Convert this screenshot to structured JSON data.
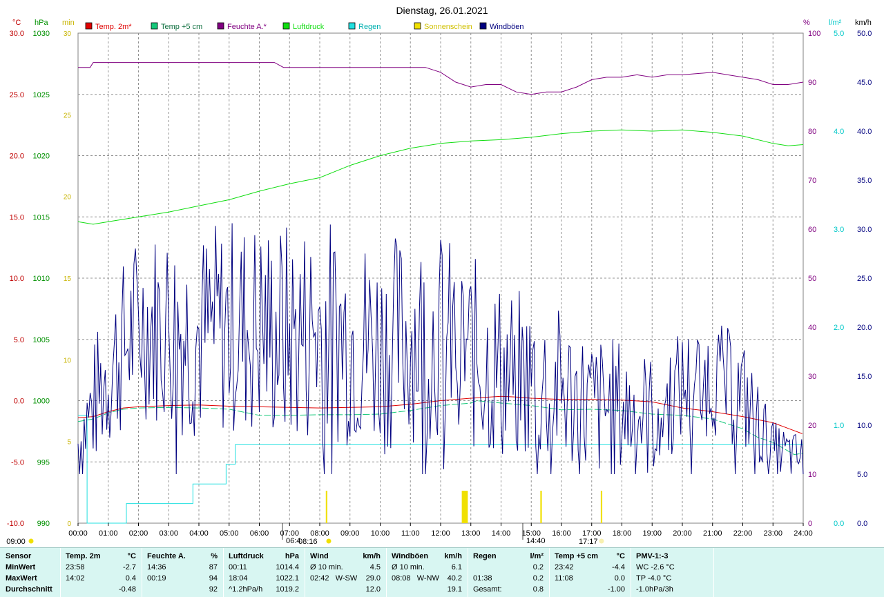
{
  "title": "Dienstag, 26.01.2021",
  "colors": {
    "temp2m": "#e00000",
    "temp5cm": "#14c87a",
    "feuchte": "#800080",
    "luftdruck": "#10dd10",
    "regen": "#22e0e0",
    "sonne": "#f0e000",
    "wind": "#00007f",
    "grid": "#909090",
    "stats_bg": "#d8f6f2"
  },
  "legend": [
    {
      "key": "temp2m",
      "label": "Temp. 2m*"
    },
    {
      "key": "temp5cm",
      "label": "Temp +5 cm"
    },
    {
      "key": "feuchte",
      "label": "Feuchte A.*"
    },
    {
      "key": "luftdruck",
      "label": "Luftdruck"
    },
    {
      "key": "regen",
      "label": "Regen"
    },
    {
      "key": "sonne",
      "label": "Sonnenschein"
    },
    {
      "key": "wind",
      "label": "Windböen"
    }
  ],
  "axis_units": {
    "temp": "°C",
    "press": "hPa",
    "sun": "min",
    "hum": "%",
    "rain": "l/m²",
    "wind": "km/h"
  },
  "axes": {
    "temp": {
      "ticks": [
        "30.0",
        "25.0",
        "20.0",
        "15.0",
        "10.0",
        "5.0",
        "0.0",
        "-5.0",
        "-10.0"
      ]
    },
    "press": {
      "ticks": [
        "1030",
        "1025",
        "1020",
        "1015",
        "1010",
        "1005",
        "1000",
        "995",
        "990"
      ]
    },
    "sun": {
      "ticks": [
        "30",
        "25",
        "20",
        "15",
        "10",
        "5",
        "0"
      ]
    },
    "hum": {
      "ticks": [
        "100",
        "90",
        "80",
        "70",
        "60",
        "50",
        "40",
        "30",
        "20",
        "10",
        "0"
      ]
    },
    "rain": {
      "ticks": [
        "5.0",
        "4.0",
        "3.0",
        "2.0",
        "1.0",
        "0.0"
      ]
    },
    "wind": {
      "ticks": [
        "50.0",
        "45.0",
        "40.0",
        "35.0",
        "30.0",
        "25.0",
        "20.0",
        "15.0",
        "10.0",
        "5.0",
        "0.0"
      ]
    },
    "time": {
      "ticks": [
        "00:00",
        "01:00",
        "02:00",
        "03:00",
        "04:00",
        "05:00",
        "06:00",
        "07:00",
        "08:00",
        "09:00",
        "10:00",
        "11:00",
        "12:00",
        "13:00",
        "14:00",
        "15:00",
        "16:00",
        "17:00",
        "18:00",
        "19:00",
        "20:00",
        "21:00",
        "22:00",
        "23:00",
        "24:00"
      ]
    }
  },
  "markers": {
    "sunrise": "08:16",
    "sunset": "17:17",
    "min_marker": "06:4",
    "max_marker": "14:40",
    "sun_duration": "09:00"
  },
  "chart_data": {
    "type": "line",
    "title": "Dienstag, 26.01.2021",
    "x_range": [
      "00:00",
      "24:00"
    ],
    "series": [
      {
        "name": "Temp. 2m*",
        "axis": "temp",
        "ylim": [
          -10,
          30
        ],
        "points": [
          [
            0,
            -1.4
          ],
          [
            0.5,
            -1.3
          ],
          [
            1,
            -0.9
          ],
          [
            1.5,
            -0.6
          ],
          [
            2,
            -0.5
          ],
          [
            3,
            -0.4
          ],
          [
            4,
            -0.35
          ],
          [
            5,
            -0.45
          ],
          [
            6,
            -0.5
          ],
          [
            7,
            -0.55
          ],
          [
            8,
            -0.6
          ],
          [
            9,
            -0.55
          ],
          [
            10,
            -0.5
          ],
          [
            11,
            -0.3
          ],
          [
            12,
            0.0
          ],
          [
            13,
            0.2
          ],
          [
            14,
            0.35
          ],
          [
            14.5,
            0.3
          ],
          [
            15,
            0.2
          ],
          [
            16,
            0.1
          ],
          [
            17,
            0.1
          ],
          [
            18,
            0.05
          ],
          [
            19,
            -0.1
          ],
          [
            20,
            -0.6
          ],
          [
            21,
            -0.9
          ],
          [
            22,
            -1.3
          ],
          [
            23,
            -1.8
          ],
          [
            23.97,
            -2.7
          ]
        ]
      },
      {
        "name": "Temp +5 cm",
        "axis": "temp",
        "ylim": [
          -10,
          30
        ],
        "points": [
          [
            0,
            -1.7
          ],
          [
            0.5,
            -1.5
          ],
          [
            1,
            -1.0
          ],
          [
            1.5,
            -0.7
          ],
          [
            2,
            -0.6
          ],
          [
            3,
            -0.55
          ],
          [
            4,
            -0.6
          ],
          [
            5,
            -0.7
          ],
          [
            6,
            -1.2
          ],
          [
            7,
            -1.2
          ],
          [
            8,
            -1.15
          ],
          [
            9,
            -1.15
          ],
          [
            10,
            -1.1
          ],
          [
            11,
            -0.8
          ],
          [
            12,
            -0.4
          ],
          [
            13,
            -0.2
          ],
          [
            13.2,
            0.0
          ],
          [
            14,
            -0.2
          ],
          [
            15,
            -0.4
          ],
          [
            16,
            -0.75
          ],
          [
            17,
            -0.7
          ],
          [
            18,
            -0.8
          ],
          [
            19,
            -1.1
          ],
          [
            20,
            -1.2
          ],
          [
            21,
            -1.5
          ],
          [
            22,
            -2.3
          ],
          [
            22.5,
            -3.0
          ],
          [
            23,
            -3.4
          ],
          [
            23.7,
            -4.4
          ],
          [
            24,
            -4.3
          ]
        ]
      },
      {
        "name": "Feuchte A.*",
        "axis": "hum",
        "ylim": [
          0,
          100
        ],
        "points": [
          [
            0,
            93
          ],
          [
            0.4,
            93
          ],
          [
            0.5,
            94
          ],
          [
            1,
            94
          ],
          [
            2,
            94
          ],
          [
            3,
            94
          ],
          [
            4,
            94
          ],
          [
            5,
            94
          ],
          [
            6,
            94
          ],
          [
            6.5,
            94
          ],
          [
            6.8,
            93
          ],
          [
            7,
            93
          ],
          [
            8,
            93
          ],
          [
            9,
            93
          ],
          [
            10,
            93
          ],
          [
            11,
            93
          ],
          [
            11.5,
            93
          ],
          [
            12,
            92
          ],
          [
            12.5,
            90
          ],
          [
            13,
            89
          ],
          [
            13.5,
            89.5
          ],
          [
            14,
            89.5
          ],
          [
            14.5,
            88
          ],
          [
            15,
            87.5
          ],
          [
            15.5,
            88
          ],
          [
            16,
            88
          ],
          [
            16.5,
            89
          ],
          [
            17,
            90.5
          ],
          [
            17.5,
            91
          ],
          [
            18,
            91
          ],
          [
            18.5,
            91.5
          ],
          [
            19,
            91
          ],
          [
            19.5,
            91.5
          ],
          [
            20,
            91.5
          ],
          [
            21,
            92
          ],
          [
            21.5,
            91.5
          ],
          [
            22,
            91
          ],
          [
            22.5,
            90.5
          ],
          [
            23,
            89.5
          ],
          [
            23.5,
            89.5
          ],
          [
            24,
            90
          ]
        ]
      },
      {
        "name": "Luftdruck",
        "axis": "press",
        "ylim": [
          990,
          1030
        ],
        "points": [
          [
            0,
            1014.6
          ],
          [
            0.5,
            1014.4
          ],
          [
            1,
            1014.6
          ],
          [
            1.5,
            1014.8
          ],
          [
            2,
            1015.0
          ],
          [
            3,
            1015.4
          ],
          [
            4,
            1015.9
          ],
          [
            5,
            1016.4
          ],
          [
            6,
            1017.1
          ],
          [
            7,
            1017.7
          ],
          [
            8,
            1018.2
          ],
          [
            9,
            1019.2
          ],
          [
            10,
            1020.0
          ],
          [
            11,
            1020.6
          ],
          [
            12,
            1021.0
          ],
          [
            13,
            1021.2
          ],
          [
            14,
            1021.3
          ],
          [
            15,
            1021.5
          ],
          [
            16,
            1021.8
          ],
          [
            17,
            1022.0
          ],
          [
            18,
            1022.1
          ],
          [
            19,
            1022.0
          ],
          [
            20,
            1022.1
          ],
          [
            21,
            1021.9
          ],
          [
            22,
            1021.6
          ],
          [
            23,
            1021.0
          ],
          [
            23.5,
            1020.8
          ],
          [
            24,
            1020.9
          ]
        ]
      },
      {
        "name": "Regen",
        "axis": "rain",
        "ylim": [
          0,
          5
        ],
        "step": true,
        "points": [
          [
            0,
            1.1
          ],
          [
            0.3,
            1.1
          ],
          [
            0.3,
            0
          ],
          [
            1.6,
            0
          ],
          [
            1.6,
            0.2
          ],
          [
            3.8,
            0.2
          ],
          [
            3.8,
            0.4
          ],
          [
            4.9,
            0.4
          ],
          [
            4.9,
            0.6
          ],
          [
            5.2,
            0.6
          ],
          [
            5.2,
            0.8
          ],
          [
            24,
            0.8
          ]
        ]
      },
      {
        "name": "Sonnenschein",
        "axis": "sun",
        "ylim": [
          0,
          30
        ],
        "bars": [
          [
            12.7,
            12.9,
            2
          ],
          [
            15.3,
            15.35,
            2
          ],
          [
            17.3,
            17.35,
            0.3
          ],
          [
            8.2,
            8.25,
            0.2
          ]
        ]
      },
      {
        "name": "Windböen",
        "axis": "wind",
        "ylim": [
          0,
          50
        ],
        "noisy": true,
        "envelope": [
          [
            0,
            9
          ],
          [
            1,
            17
          ],
          [
            2,
            22
          ],
          [
            3,
            22
          ],
          [
            4,
            21
          ],
          [
            5,
            22
          ],
          [
            6,
            22
          ],
          [
            7,
            21
          ],
          [
            8,
            22
          ],
          [
            9,
            21
          ],
          [
            10,
            20
          ],
          [
            11,
            21
          ],
          [
            12,
            21
          ],
          [
            13,
            19
          ],
          [
            14,
            17
          ],
          [
            15,
            16
          ],
          [
            16,
            15
          ],
          [
            17,
            13
          ],
          [
            18,
            13
          ],
          [
            19,
            12
          ],
          [
            20,
            15
          ],
          [
            21,
            16
          ],
          [
            22,
            14
          ],
          [
            23,
            8
          ],
          [
            24,
            7
          ]
        ],
        "amplitude": [
          [
            0,
            4
          ],
          [
            1,
            7
          ],
          [
            3,
            9
          ],
          [
            7,
            10
          ],
          [
            12,
            9
          ],
          [
            14,
            8
          ],
          [
            18,
            6
          ],
          [
            20,
            5
          ],
          [
            22,
            5
          ],
          [
            23,
            2.5
          ],
          [
            24,
            2
          ]
        ]
      }
    ]
  },
  "stats": {
    "cols": [
      {
        "header": "Sensor",
        "unit": "",
        "rows": [
          [
            "MinWert"
          ],
          [
            "MaxWert"
          ],
          [
            "Durchschnitt"
          ]
        ]
      },
      {
        "header": "Temp. 2m",
        "unit": "°C",
        "rows": [
          [
            "23:58",
            "-2.7"
          ],
          [
            "14:02",
            "0.4"
          ],
          [
            "",
            "-0.48"
          ]
        ]
      },
      {
        "header": "Feuchte A.",
        "unit": "%",
        "rows": [
          [
            "14:36",
            "87"
          ],
          [
            "00:19",
            "94"
          ],
          [
            "",
            "92"
          ]
        ]
      },
      {
        "header": "Luftdruck",
        "unit": "hPa",
        "rows": [
          [
            "00:11",
            "1014.4"
          ],
          [
            "18:04",
            "1022.1"
          ],
          [
            "^1.2hPa/h",
            "1019.2"
          ]
        ]
      },
      {
        "header": "Wind",
        "unit": "km/h",
        "rows": [
          [
            "Ø 10 min.",
            "4.5"
          ],
          [
            "02:42   W-SW",
            "29.0"
          ],
          [
            "",
            "12.0"
          ]
        ]
      },
      {
        "header": "Windböen",
        "unit": "km/h",
        "rows": [
          [
            "Ø 10 min.",
            "6.1"
          ],
          [
            "08:08   W-NW",
            "40.2"
          ],
          [
            "",
            "19.1"
          ]
        ]
      },
      {
        "header": "Regen",
        "unit": "l/m²",
        "rows": [
          [
            "",
            "0.2"
          ],
          [
            "01:38",
            "0.2"
          ],
          [
            "Gesamt:",
            "0.8"
          ]
        ]
      },
      {
        "header": "Temp +5 cm",
        "unit": "°C",
        "rows": [
          [
            "23:42",
            "-4.4"
          ],
          [
            "11:08",
            "0.0"
          ],
          [
            "",
            "-1.00"
          ]
        ]
      },
      {
        "header": "PMV-1:-3",
        "unit": "",
        "rows": [
          [
            "WC -2.6 °C"
          ],
          [
            "TP -4.0 °C"
          ],
          [
            "-1.0hPa/3h"
          ]
        ]
      }
    ]
  }
}
